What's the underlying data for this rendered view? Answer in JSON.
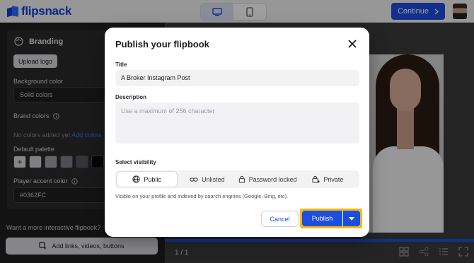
{
  "topbar": {
    "logo_text": "flipsnack",
    "continue_label": "Continue",
    "brand_color": "#1d4ee0"
  },
  "sidebar": {
    "branding_title": "Branding",
    "upload_logo_label": "Upload logo",
    "background_color_label": "Background color",
    "background_color_value": "Solid colors",
    "brand_colors_label": "Brand colors",
    "no_colors_text": "No colors added yet",
    "add_colors_link": "Add colors",
    "default_palette_label": "Default palette",
    "palette_swatches": [
      "#cfcfd3",
      "#a3a3a8",
      "#7f7f86",
      "#55555c",
      "#0a0a0a",
      "#9ec7a2"
    ],
    "player_accent_label": "Player accent color",
    "player_accent_value": "#0362FC",
    "cta_text": "Want a more interactive flipbook?",
    "add_links_label": "Add links, videos, buttons"
  },
  "preview": {
    "page_number": "1 / 1"
  },
  "modal": {
    "title": "Publish your flipbook",
    "title_label": "Title",
    "title_value": "A Broker Instagram Post",
    "description_label": "Description",
    "description_placeholder": "Use a maximum of 256 character",
    "visibility_label": "Select visibility",
    "visibility_options": [
      {
        "label": "Public",
        "icon": "globe-icon",
        "selected": true
      },
      {
        "label": "Unlisted",
        "icon": "link-icon",
        "selected": false
      },
      {
        "label": "Password locked",
        "icon": "lock-icon",
        "selected": false
      },
      {
        "label": "Private",
        "icon": "private-lock-icon",
        "selected": false
      }
    ],
    "visibility_help": "Visible on your profile and indexed by search engines (Google, Bing, etc).",
    "cancel_label": "Cancel",
    "publish_label": "Publish",
    "highlight_color": "#f5b800"
  }
}
